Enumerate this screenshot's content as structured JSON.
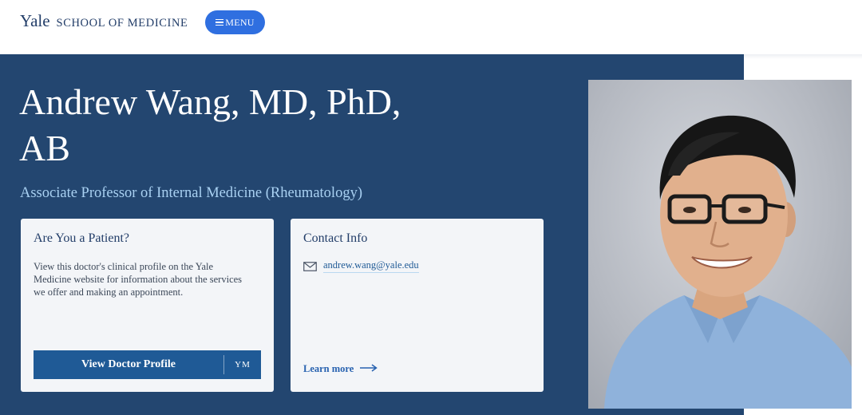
{
  "header": {
    "brand_name": "Yale",
    "brand_school": "SCHOOL OF MEDICINE",
    "menu_label": "MENU"
  },
  "profile": {
    "name_line1": "Andrew Wang, MD, PhD,",
    "name_line2": "AB",
    "title": "Associate Professor of Internal Medicine (Rheumatology)"
  },
  "patient_card": {
    "heading": "Are You a Patient?",
    "text": "View this doctor's clinical profile on the Yale Medicine website for information about the services we offer and making an appointment.",
    "button_label": "View Doctor Profile",
    "button_mark": "YM"
  },
  "contact_card": {
    "heading": "Contact Info",
    "email": "andrew.wang@yale.edu",
    "learn_more": "Learn more"
  },
  "colors": {
    "hero_background": "#234670",
    "menu_button": "#2f6fe0",
    "profile_button": "#1f5a96",
    "title_text": "#a9d1f2"
  },
  "icons": [
    "menu-icon",
    "mail-icon",
    "arrow-right-icon"
  ]
}
